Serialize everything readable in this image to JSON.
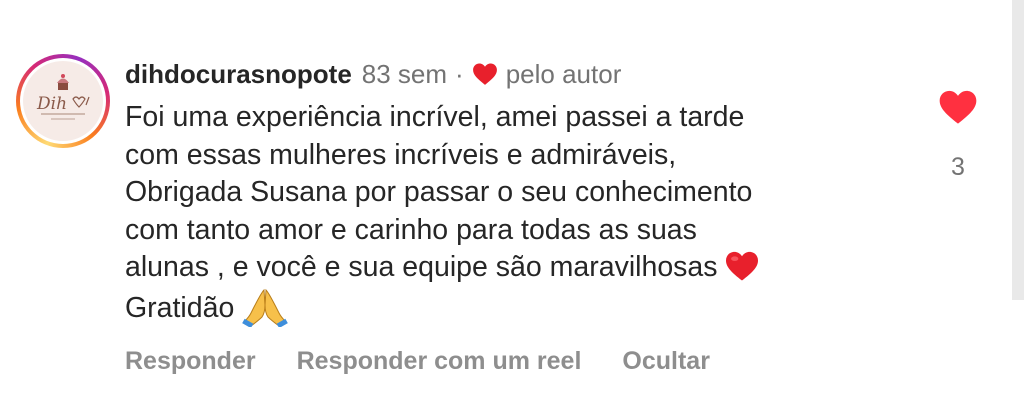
{
  "comment": {
    "username": "dihdocurasnopote",
    "time": "83 sem",
    "separator": "·",
    "liked_by_author": "pelo autor",
    "avatar_logo_text": "Dih",
    "text_lines": [
      "Foi uma experiência incrível, amei passei a tarde",
      "com essas mulheres incríveis e admiráveis,",
      "Obrigada Susana por passar o seu conhecimento",
      "com tanto amor e carinho para todas as suas",
      "alunas , e você e sua equipe são maravilhosas",
      "Gratidão"
    ],
    "like_count": "3",
    "actions": {
      "reply": "Responder",
      "reply_with_reel": "Responder com um reel",
      "hide": "Ocultar"
    }
  },
  "icons": {
    "author_heart": "heart-icon",
    "like_heart": "heart-filled-icon",
    "emoji_heart": "red-heart-emoji",
    "emoji_pray": "folded-hands-emoji"
  },
  "colors": {
    "heart_red": "#ff3040",
    "emoji_heart_red": "#e8202c",
    "text": "#262626",
    "secondary": "#737373",
    "action": "#8e8e8e"
  }
}
